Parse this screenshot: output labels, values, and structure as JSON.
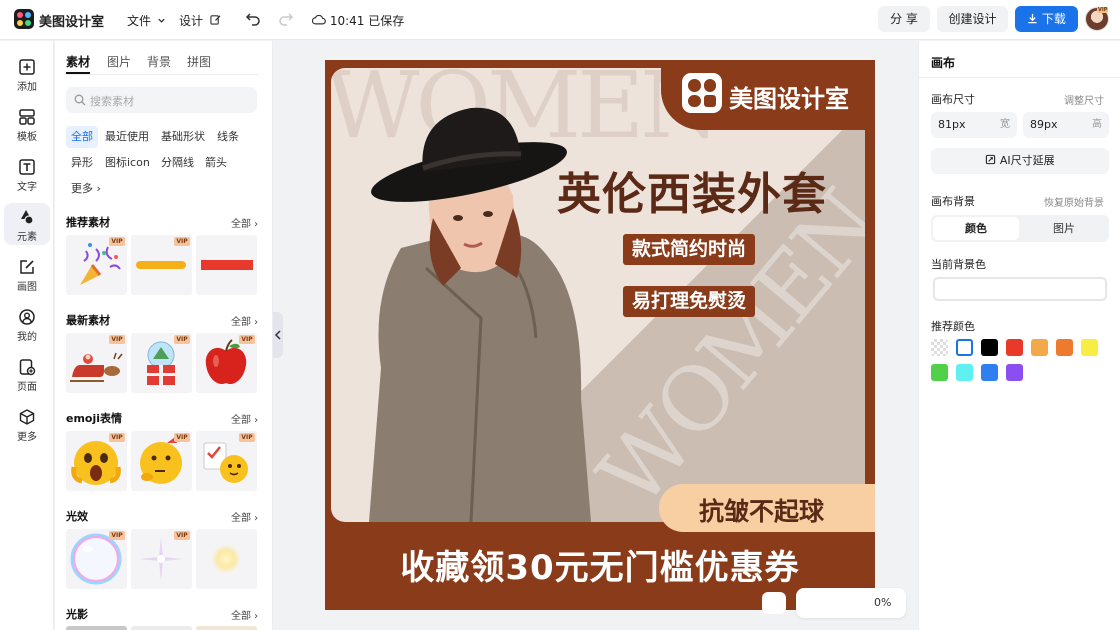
{
  "topbar": {
    "app_name": "美图设计室",
    "menu_file": "文件",
    "menu_design": "设计",
    "save_status": "10:41 已保存",
    "share_label": "分 享",
    "create_label": "创建设计",
    "download_label": "下载",
    "avatar_badge": "VIP",
    "accent_color": "#1a73e8"
  },
  "left_nav": {
    "items": [
      {
        "label": "添加",
        "icon": "plus-square-icon"
      },
      {
        "label": "模板",
        "icon": "template-grid-icon"
      },
      {
        "label": "文字",
        "icon": "text-t-icon"
      },
      {
        "label": "元素",
        "icon": "shapes-icon"
      },
      {
        "label": "画图",
        "icon": "pencil-edit-icon"
      },
      {
        "label": "我的",
        "icon": "user-circle-icon"
      },
      {
        "label": "页面",
        "icon": "page-add-icon"
      },
      {
        "label": "更多",
        "icon": "cube-icon"
      }
    ],
    "active_index": 3
  },
  "panel": {
    "tabs": [
      "素材",
      "图片",
      "背景",
      "拼图"
    ],
    "active_tab": 0,
    "search_placeholder": "搜索素材",
    "chips": [
      "全部",
      "最近使用",
      "基础形状",
      "线条",
      "异形",
      "图标icon",
      "分隔线",
      "箭头",
      "更多"
    ],
    "active_chip": 0,
    "all_label": "全部",
    "vip_label": "VIP",
    "sections": [
      {
        "title": "推荐素材",
        "items": [
          "confetti-popper",
          "yellow-brush-stroke",
          "red-rectangle"
        ]
      },
      {
        "title": "最新素材",
        "items": [
          "santa-sleigh",
          "christmas-gift-snowglobe",
          "red-apple"
        ]
      },
      {
        "title": "emoji表情",
        "items": [
          "shocked-emoji",
          "thinking-emoji",
          "checklist-emoji"
        ]
      },
      {
        "title": "光效",
        "items": [
          "rainbow-bubble",
          "sparkle-star",
          "glow-light"
        ]
      },
      {
        "title": "光影",
        "items": []
      }
    ]
  },
  "canvas": {
    "brand": "美图设计室",
    "headline": "英伦西装外套",
    "tag1": "款式简约时尚",
    "tag2": "易打理免熨烫",
    "badge": "抗皱不起球",
    "bottom_banner": "收藏领30元无门槛优惠券",
    "watermark": "WOMEN",
    "colors": {
      "frame": "#8a3b1a",
      "panel": "#ede3db",
      "badge": "#f7cfa3"
    },
    "zoom_fragment": "0%"
  },
  "right_panel": {
    "title": "画布",
    "size_label": "画布尺寸",
    "size_hint": "调整尺寸",
    "width_value": "81px",
    "width_unit": "宽",
    "height_value": "89px",
    "height_unit": "高",
    "ai_extend_label": "AI尺寸延展",
    "bg_label": "画布背景",
    "bg_restore": "恢复原始背景",
    "seg_color": "颜色",
    "seg_image": "图片",
    "current_bg_label": "当前背景色",
    "recommend_label": "推荐颜色",
    "swatches": [
      "transparent",
      "#ffffff",
      "#000000",
      "#e8392a",
      "#f3a84a",
      "#ee7a2e",
      "#f6ee43",
      "#51d04a",
      "#5ff0ef",
      "#2f7ff0",
      "#8b4ff1"
    ]
  }
}
